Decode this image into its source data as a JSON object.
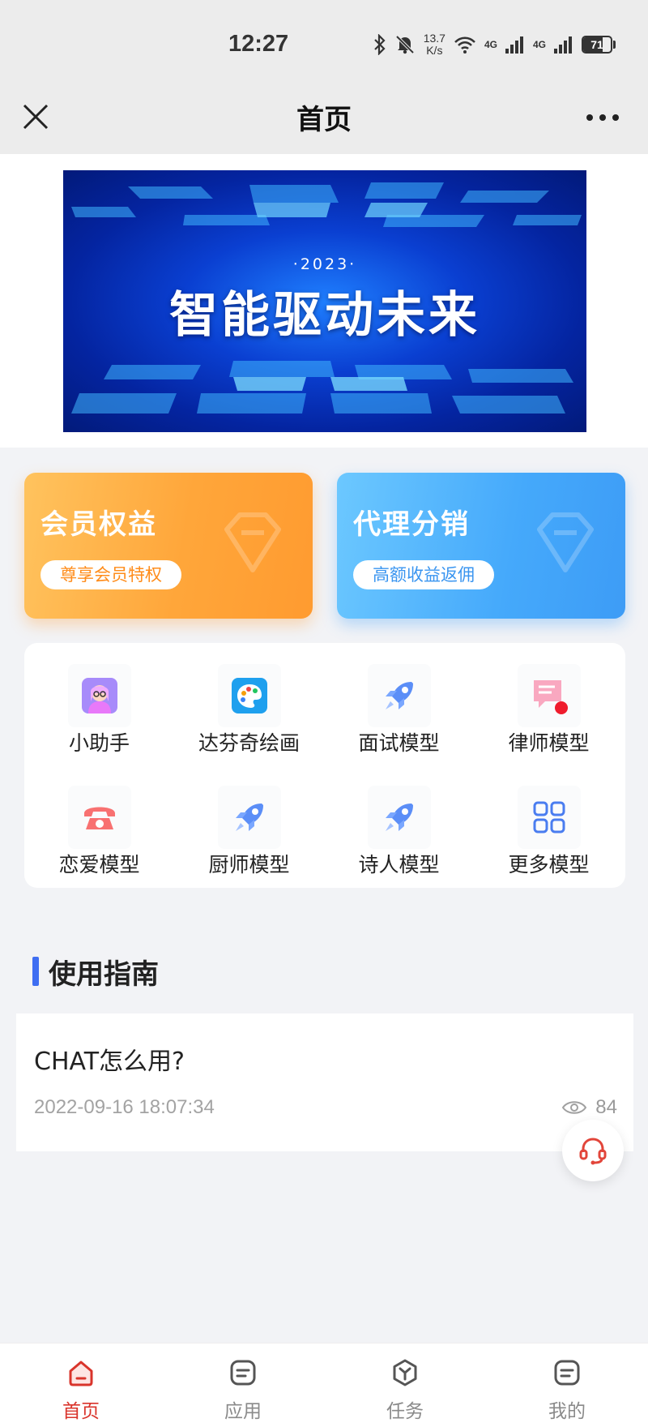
{
  "status_bar": {
    "time": "12:27",
    "speed_value": "13.7",
    "speed_unit": "K/s",
    "net1": "4G",
    "net2": "4G",
    "battery": "71",
    "battery_level": 0.71
  },
  "nav": {
    "title": "首页"
  },
  "banner": {
    "year": "·2023·",
    "headline": "智能驱动未来"
  },
  "promos": [
    {
      "title": "会员权益",
      "pill": "尊享会员特权"
    },
    {
      "title": "代理分销",
      "pill": "高额收益返佣"
    }
  ],
  "grid": [
    {
      "label": "小助手",
      "icon": "assistant-avatar-icon"
    },
    {
      "label": "达芬奇绘画",
      "icon": "palette-icon"
    },
    {
      "label": "面试模型",
      "icon": "rocket-icon"
    },
    {
      "label": "律师模型",
      "icon": "chat-document-icon"
    },
    {
      "label": "恋爱模型",
      "icon": "phone-icon"
    },
    {
      "label": "厨师模型",
      "icon": "rocket-icon"
    },
    {
      "label": "诗人模型",
      "icon": "rocket-icon"
    },
    {
      "label": "更多模型",
      "icon": "grid-icon"
    }
  ],
  "guide": {
    "title": "使用指南",
    "articles": [
      {
        "title": "CHAT怎么用?",
        "date": "2022-09-16 18:07:34",
        "views": "84"
      }
    ]
  },
  "tabbar": [
    {
      "label": "首页",
      "icon": "home-icon",
      "active": true
    },
    {
      "label": "应用",
      "icon": "apps-icon",
      "active": false
    },
    {
      "label": "任务",
      "icon": "task-icon",
      "active": false
    },
    {
      "label": "我的",
      "icon": "profile-icon",
      "active": false
    }
  ],
  "colors": {
    "accent": "#d9342b",
    "guide_bar": "#3f6ef2",
    "vip_orange": "#ffa63a",
    "agent_blue": "#45a9fb"
  }
}
